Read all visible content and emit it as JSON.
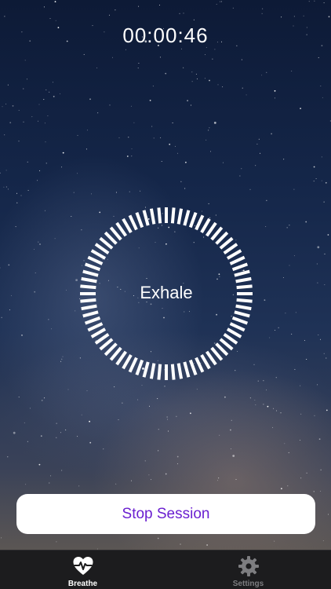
{
  "session": {
    "timer": "00:00:46",
    "phase": "Exhale",
    "stop_label": "Stop Session"
  },
  "tabs": [
    {
      "label": "Breathe",
      "icon": "heart-pulse-icon",
      "active": true
    },
    {
      "label": "Settings",
      "icon": "gear-icon",
      "active": false
    }
  ],
  "colors": {
    "accent": "#6a1fd0",
    "tabbar_bg": "#1c1c1e",
    "inactive_tab": "#7d7d80"
  }
}
